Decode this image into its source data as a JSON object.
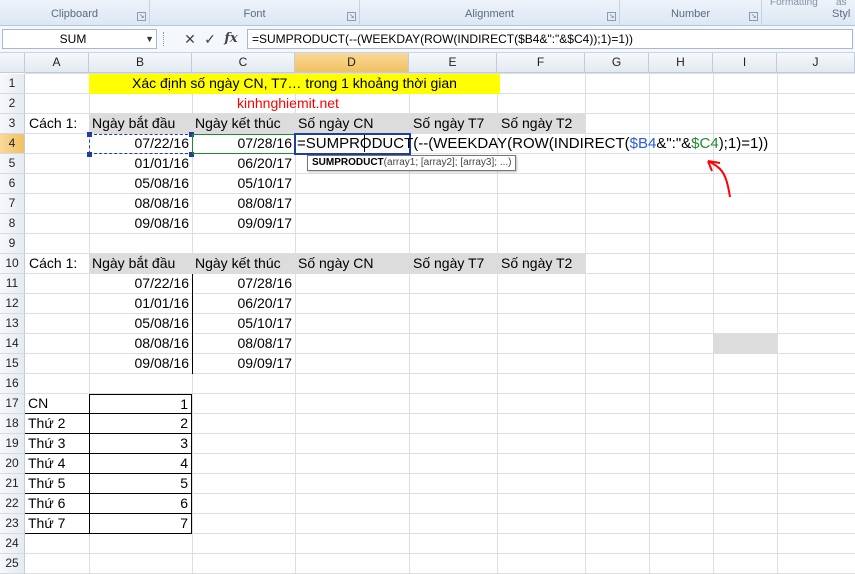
{
  "ribbon": {
    "groups": [
      "Clipboard",
      "Font",
      "Alignment",
      "Number"
    ],
    "top_fragments": [
      "Formatting",
      "as"
    ],
    "cut_label": "Styl"
  },
  "formula_bar": {
    "name_box": "SUM",
    "cancel": "✕",
    "enter": "✓",
    "fx": "fx",
    "formula": "=SUMPRODUCT(--(WEEKDAY(ROW(INDIRECT($B4&\":\"&$C4));1)=1))"
  },
  "columns": [
    "A",
    "B",
    "C",
    "D",
    "E",
    "F",
    "G",
    "H",
    "I",
    "J"
  ],
  "rows": [
    "1",
    "2",
    "3",
    "4",
    "5",
    "6",
    "7",
    "8",
    "9",
    "10",
    "11",
    "12",
    "13",
    "14",
    "15",
    "16",
    "17",
    "18",
    "19",
    "20",
    "21",
    "22",
    "23",
    "24",
    "25"
  ],
  "sheet": {
    "title": "Xác định số ngày CN, T7… trong 1 khoảng thời gian",
    "watermark": "kinhnghiemit.net",
    "method_label": "Cách 1:",
    "headers": [
      "Ngày bắt đầu",
      "Ngày kết thúc",
      "Số ngày CN",
      "Số ngày T7",
      "Số ngày T2"
    ],
    "start_dates": [
      "07/22/16",
      "01/01/16",
      "05/08/16",
      "08/08/16",
      "09/08/16"
    ],
    "end_dates": [
      "07/28/16",
      "06/20/17",
      "05/10/17",
      "08/08/17",
      "09/09/17"
    ],
    "editing_formula_pre": "=SUMPRODUCT(--(WEEKDAY(ROW(INDIRECT(",
    "editing_ref1": "$B4",
    "editing_mid": "&\":\"&",
    "editing_ref2": "$C4",
    "editing_post": ");1)=1))",
    "tooltip_fn": "SUMPRODUCT",
    "tooltip_args": "(array1; [array2]; [array3]; ...)",
    "weekday_names": [
      "CN",
      "Thứ 2",
      "Thứ 3",
      "Thứ 4",
      "Thứ 5",
      "Thứ 6",
      "Thứ 7"
    ],
    "weekday_numbers": [
      "1",
      "2",
      "3",
      "4",
      "5",
      "6",
      "7"
    ]
  },
  "colors": {
    "title_fill": "#ffff00",
    "header_fill": "#dcdcdc",
    "watermark": "#ff0000",
    "annotation_arrow": "#ff0000"
  }
}
